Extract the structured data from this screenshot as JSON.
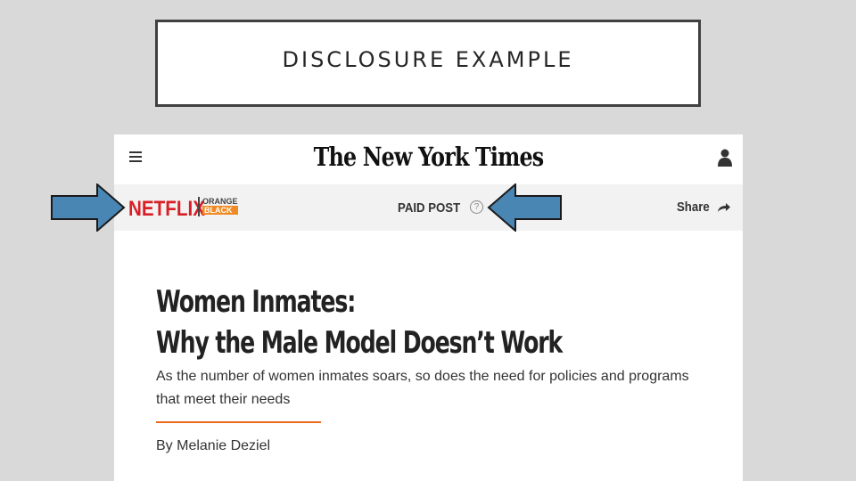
{
  "slide": {
    "title": "DISCLOSURE EXAMPLE"
  },
  "nyt": {
    "masthead": "The New York Times",
    "menu_icon": "hamburger-menu-icon",
    "account_icon": "user-icon"
  },
  "sponsor_bar": {
    "sponsor_logo": "NETFLIX",
    "show_logo_line1": "ORANGE",
    "show_logo_line2": "BLACK",
    "paid_post_label": "PAID POST",
    "help_glyph": "?",
    "share_label": "Share",
    "share_icon": "share-arrow-icon"
  },
  "article": {
    "headline_line1": "Women Inmates:",
    "headline_line2": "Why the Male Model Doesn’t Work",
    "dek": "As the number of women inmates soars, so does the need for policies and programs that meet their needs",
    "byline": "By Melanie Deziel"
  },
  "annotations": {
    "arrow_color": "#4a86b4",
    "arrow_icons": [
      "right-arrow-icon",
      "left-arrow-icon"
    ]
  },
  "colors": {
    "netflix_red": "#d81f26",
    "accent_orange": "#e86a1c",
    "slide_background": "#d9d9d9"
  }
}
